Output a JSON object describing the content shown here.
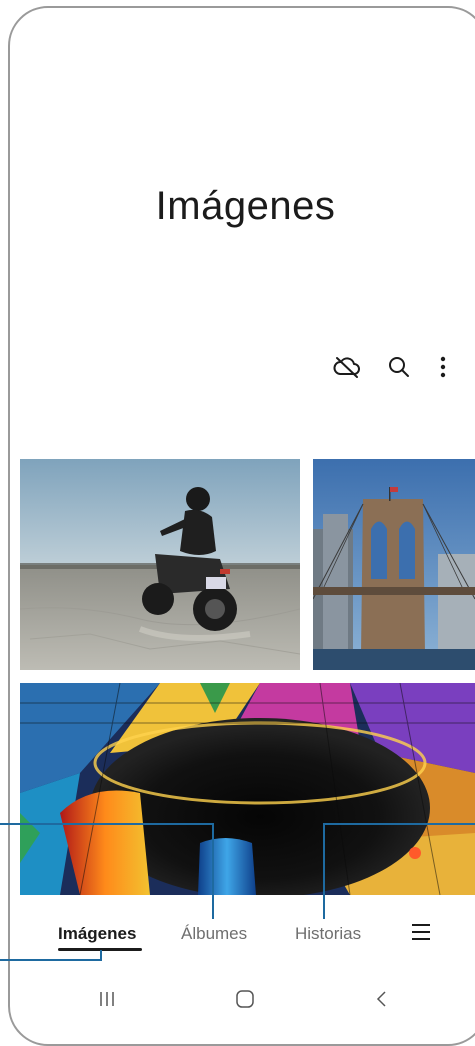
{
  "header": {
    "title": "Imágenes"
  },
  "toolbar": {
    "icons": [
      "cloud-off-icon",
      "search-icon",
      "more-options-icon"
    ]
  },
  "photos": [
    {
      "name": "motorcycle-desert"
    },
    {
      "name": "brooklyn-bridge"
    },
    {
      "name": "stained-glass-dome"
    }
  ],
  "bottom_nav": {
    "tabs": [
      {
        "label": "Imágenes",
        "active": true
      },
      {
        "label": "Álbumes",
        "active": false
      },
      {
        "label": "Historias",
        "active": false
      }
    ],
    "menu_icon": "hamburger-menu-icon"
  },
  "system_nav": [
    "recents-icon",
    "home-icon",
    "back-icon"
  ],
  "colors": {
    "accent": "#1b1b1b",
    "callout": "#1e6aa0"
  }
}
